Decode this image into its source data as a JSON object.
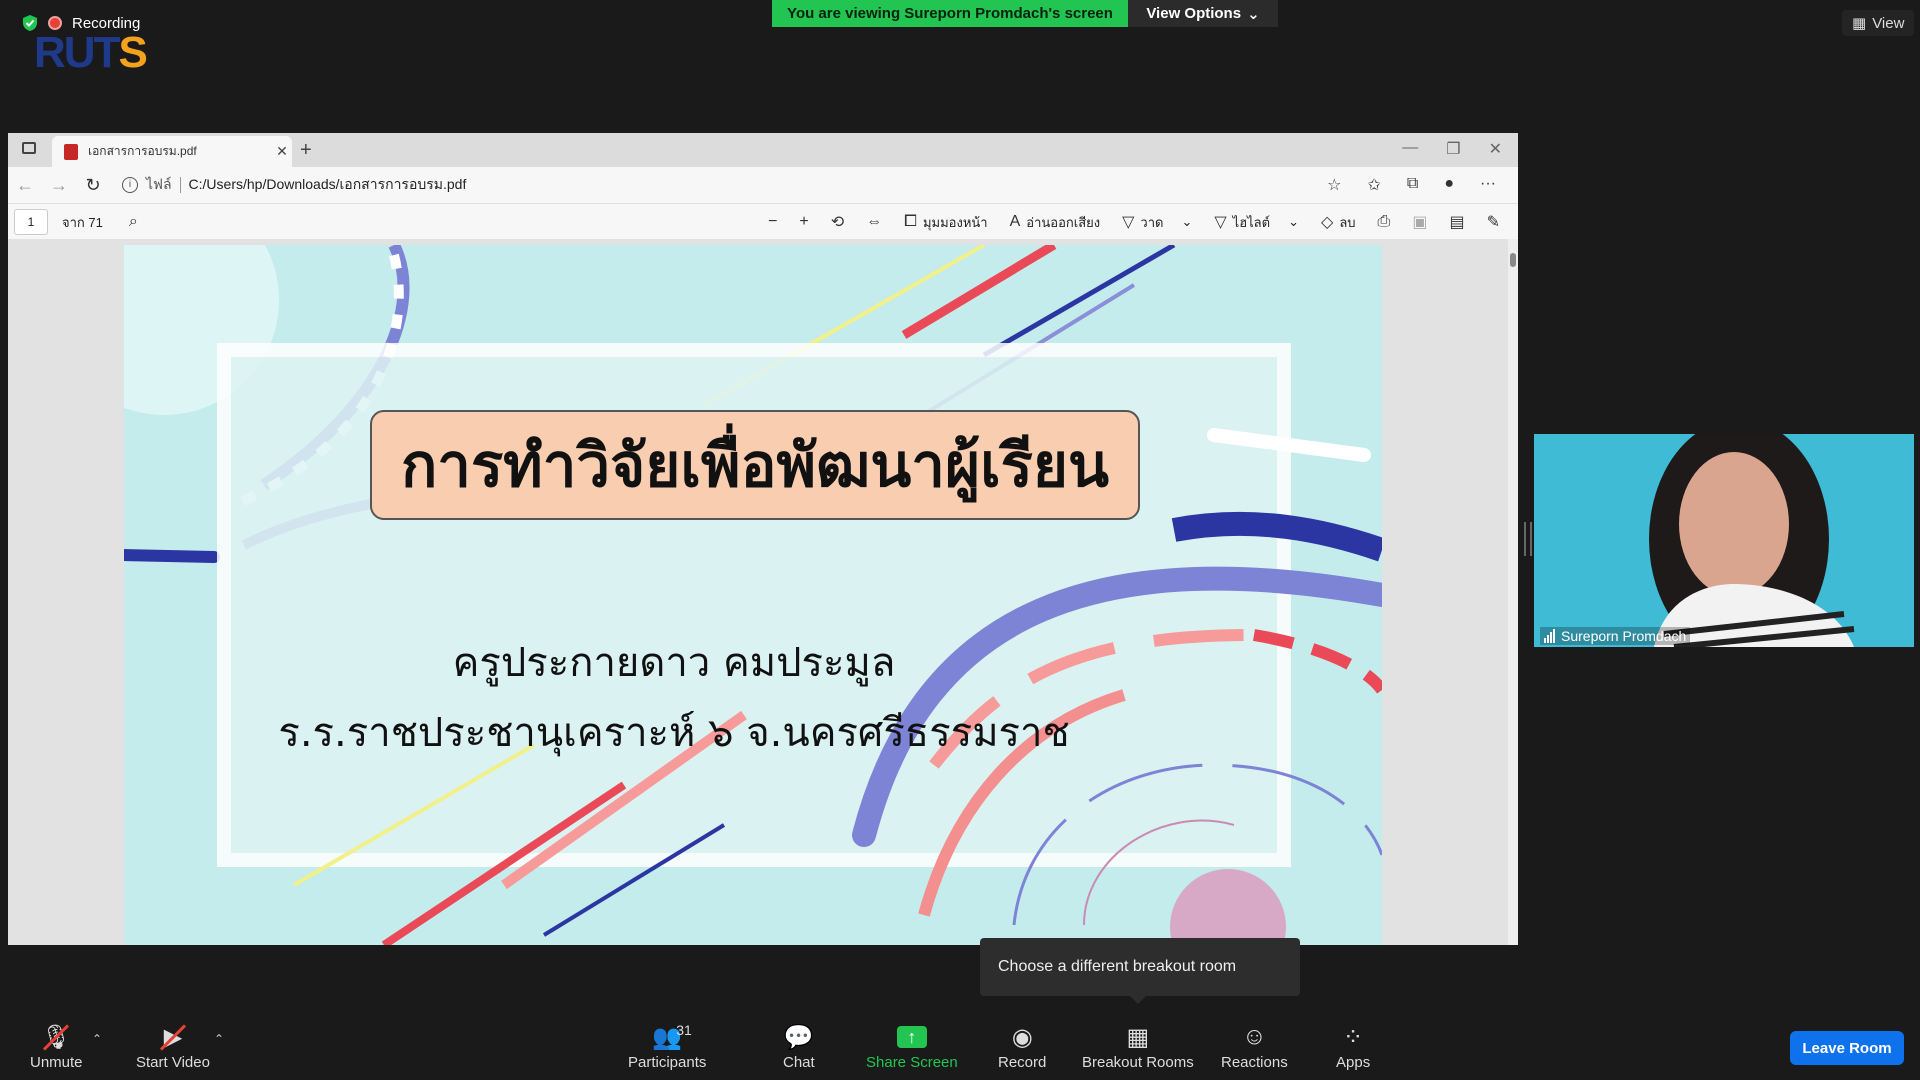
{
  "status": {
    "recording_label": "Recording"
  },
  "logo": {
    "text_r": "RUT",
    "text_s": "S"
  },
  "share_banner": {
    "text": "You are viewing Sureporn Promdach's screen",
    "view_options_label": "View Options"
  },
  "top_right": {
    "view_label": "View"
  },
  "browser": {
    "tab_title": "เอกสารการอบรม.pdf",
    "address": {
      "scheme_label": "ไฟล์",
      "url": "C:/Users/hp/Downloads/เอกสารการอบรม.pdf"
    },
    "pdf_toolbar": {
      "page_number": "1",
      "page_of": "จาก 71",
      "page_view_label": "มุมมองหน้า",
      "read_aloud_label": "อ่านออกเสียง",
      "draw_label": "วาด",
      "highlight_label": "ไฮไลต์",
      "erase_label": "ลบ"
    },
    "slide": {
      "title": "การทำวิจัยเพื่อพัฒนาผู้เรียน",
      "author": "ครูประกายดาว คมประมูล",
      "school": "ร.ร.ราชประชานุเคราะห์ ๖ จ.นครศรีธรรมราช"
    }
  },
  "video": {
    "participant_name": "Sureporn Promdach"
  },
  "tooltip": {
    "text": "Choose a different breakout room"
  },
  "toolbar": {
    "unmute_label": "Unmute",
    "start_video_label": "Start Video",
    "participants_label": "Participants",
    "participants_count": "31",
    "chat_label": "Chat",
    "share_screen_label": "Share Screen",
    "record_label": "Record",
    "breakout_rooms_label": "Breakout Rooms",
    "reactions_label": "Reactions",
    "apps_label": "Apps",
    "leave_label": "Leave Room"
  },
  "colors": {
    "share_green": "#23c552",
    "leave_blue": "#0e72ed",
    "slide_bg": "#c5ecec",
    "title_box": "#f9cdb0"
  }
}
